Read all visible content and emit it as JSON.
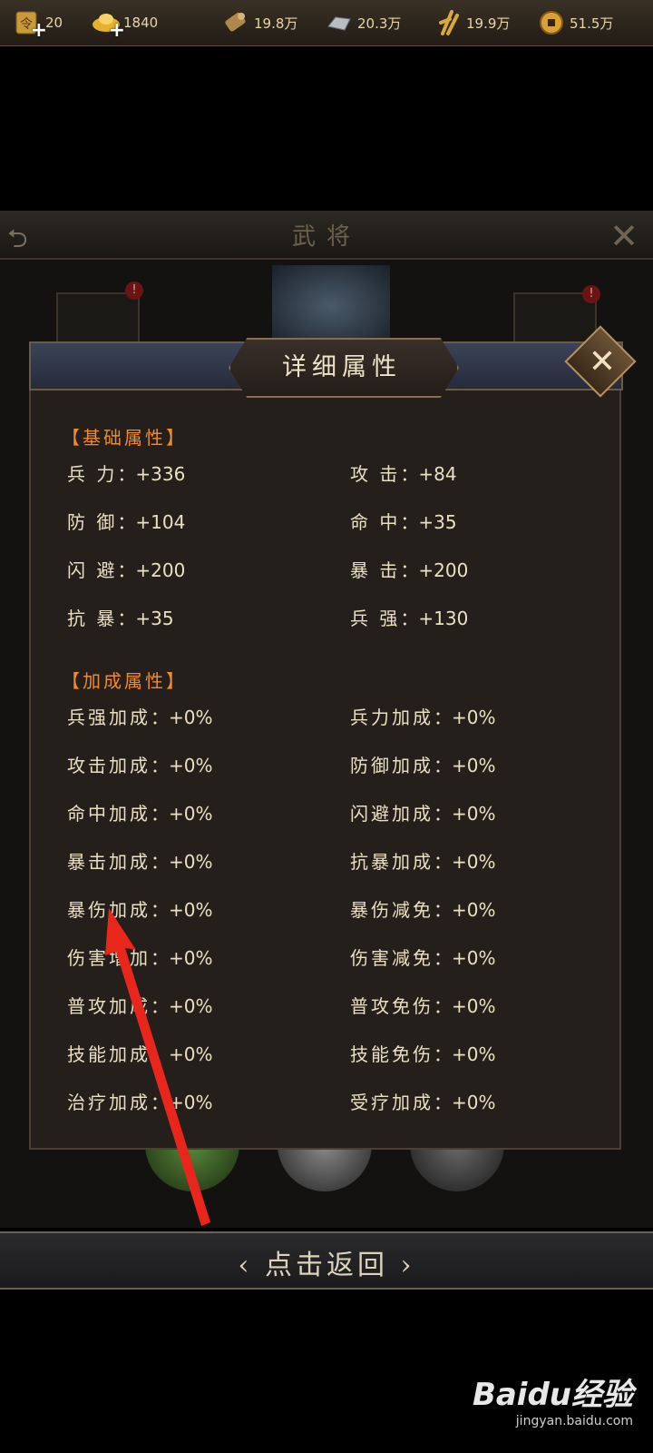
{
  "resources": [
    {
      "icon": "token-icon",
      "value": "20"
    },
    {
      "icon": "gold-ingot-icon",
      "value": "1840"
    },
    {
      "icon": "wood-icon",
      "value": "19.8万"
    },
    {
      "icon": "iron-icon",
      "value": "20.3万"
    },
    {
      "icon": "grain-icon",
      "value": "19.9万"
    },
    {
      "icon": "coin-icon",
      "value": "51.5万"
    }
  ],
  "scene": {
    "title": "武将"
  },
  "modal": {
    "title": "详细属性",
    "base_title": "【基础属性】",
    "base": [
      {
        "label": "兵  力",
        "value": "+336"
      },
      {
        "label": "攻  击",
        "value": "+84"
      },
      {
        "label": "防  御",
        "value": "+104"
      },
      {
        "label": "命  中",
        "value": "+35"
      },
      {
        "label": "闪  避",
        "value": "+200"
      },
      {
        "label": "暴  击",
        "value": "+200"
      },
      {
        "label": "抗  暴",
        "value": "+35"
      },
      {
        "label": "兵  强",
        "value": "+130"
      }
    ],
    "bonus_title": "【加成属性】",
    "bonus": [
      {
        "label": "兵强加成",
        "value": "+0%"
      },
      {
        "label": "兵力加成",
        "value": "+0%"
      },
      {
        "label": "攻击加成",
        "value": "+0%"
      },
      {
        "label": "防御加成",
        "value": "+0%"
      },
      {
        "label": "命中加成",
        "value": "+0%"
      },
      {
        "label": "闪避加成",
        "value": "+0%"
      },
      {
        "label": "暴击加成",
        "value": "+0%"
      },
      {
        "label": "抗暴加成",
        "value": "+0%"
      },
      {
        "label": "暴伤加成",
        "value": "+0%"
      },
      {
        "label": "暴伤减免",
        "value": "+0%"
      },
      {
        "label": "伤害增加",
        "value": "+0%"
      },
      {
        "label": "伤害减免",
        "value": "+0%"
      },
      {
        "label": "普攻加成",
        "value": "+0%"
      },
      {
        "label": "普攻免伤",
        "value": "+0%"
      },
      {
        "label": "技能加成",
        "value": "+0%"
      },
      {
        "label": "技能免伤",
        "value": "+0%"
      },
      {
        "label": "治疗加成",
        "value": "+0%"
      },
      {
        "label": "受疗加成",
        "value": "+0%"
      }
    ]
  },
  "return_label": "点击返回",
  "watermark": {
    "brand": "Baidu经验",
    "url": "jingyan.baidu.com"
  },
  "colors": {
    "section_title": "#f08a2a",
    "stat_text": "#ebdfc3",
    "annotation_arrow": "#e8261c"
  }
}
